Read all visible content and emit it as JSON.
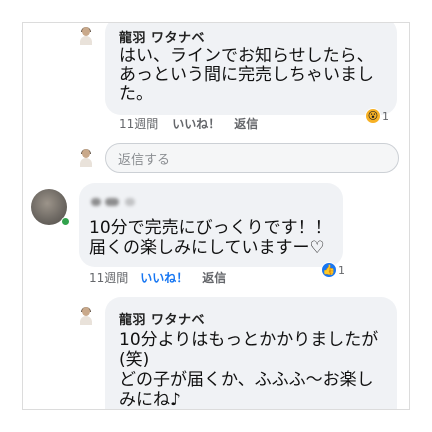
{
  "comments": [
    {
      "author": "龍羽 ワタナベ",
      "lines": [
        "はい、ラインでお知らせしたら、",
        "あっという間に完売しちゃいまし",
        "た。"
      ],
      "time": "11週間",
      "like": "いいね！",
      "reply": "返信",
      "reaction": {
        "icon": "wow-icon",
        "emoji": "😮",
        "count": "1",
        "color": "#f7b125"
      }
    },
    {
      "author": "",
      "lines": [
        "10分で完売にびっくりです！！",
        "届くの楽しみにしていますー♡"
      ],
      "time": "11週間",
      "like": "いいね！",
      "reply": "返信",
      "reaction": {
        "icon": "like-icon",
        "emoji": "👍",
        "count": "1",
        "color": "#1877f2"
      }
    },
    {
      "author": "龍羽 ワタナベ",
      "lines": [
        "10分よりはもっとかかりましたが",
        "(笑)",
        "どの子が届くか、ふふふ〜お楽し",
        "みにね♪"
      ]
    }
  ],
  "reply_input": {
    "placeholder": "返信する"
  }
}
